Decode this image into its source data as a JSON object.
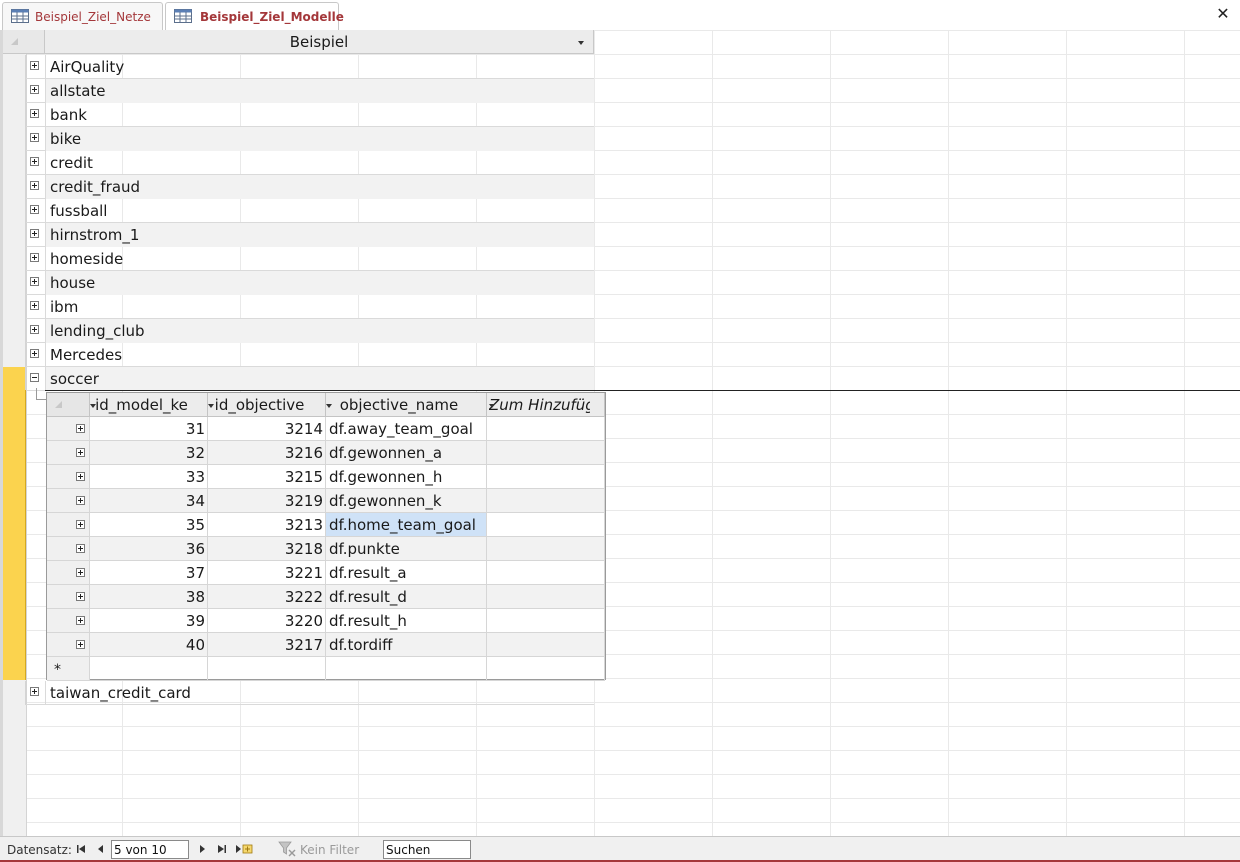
{
  "tabs": [
    {
      "label": "Beispiel_Ziel_Netze",
      "active": false
    },
    {
      "label": "Beispiel_Ziel_Modelle",
      "active": true
    }
  ],
  "close_icon": "close-icon",
  "main_table": {
    "column_header": "Beispiel",
    "rows": [
      "AirQuality",
      "allstate",
      "bank",
      "bike",
      "credit",
      "credit_fraud",
      "fussball",
      "hirnstrom_1",
      "homeside",
      "house",
      "ibm",
      "lending_club",
      "Mercedes",
      "soccer",
      "taiwan_credit_card"
    ],
    "expanded_row": "soccer"
  },
  "sub_table": {
    "headers": [
      "id_model_ke",
      "id_objective",
      "objective_name",
      "Zum Hinzufüg"
    ],
    "rows": [
      {
        "id_model": "31",
        "id_objective": "3214",
        "objective_name": "df.away_team_goal"
      },
      {
        "id_model": "32",
        "id_objective": "3216",
        "objective_name": "df.gewonnen_a"
      },
      {
        "id_model": "33",
        "id_objective": "3215",
        "objective_name": "df.gewonnen_h"
      },
      {
        "id_model": "34",
        "id_objective": "3219",
        "objective_name": "df.gewonnen_k"
      },
      {
        "id_model": "35",
        "id_objective": "3213",
        "objective_name": "df.home_team_goal"
      },
      {
        "id_model": "36",
        "id_objective": "3218",
        "objective_name": "df.punkte"
      },
      {
        "id_model": "37",
        "id_objective": "3221",
        "objective_name": "df.result_a"
      },
      {
        "id_model": "38",
        "id_objective": "3222",
        "objective_name": "df.result_d"
      },
      {
        "id_model": "39",
        "id_objective": "3220",
        "objective_name": "df.result_h"
      },
      {
        "id_model": "40",
        "id_objective": "3217",
        "objective_name": "df.tordiff"
      }
    ],
    "new_record_marker": "*",
    "highlighted_row": 4
  },
  "status_bar": {
    "label": "Datensatz:",
    "record_position": "5 von 10",
    "filter_label": "Kein Filter",
    "search_value": "Suchen"
  },
  "colors": {
    "accent": "#a4373a",
    "selected_row": "#fbd34e",
    "highlight": "#cfe2f7"
  }
}
